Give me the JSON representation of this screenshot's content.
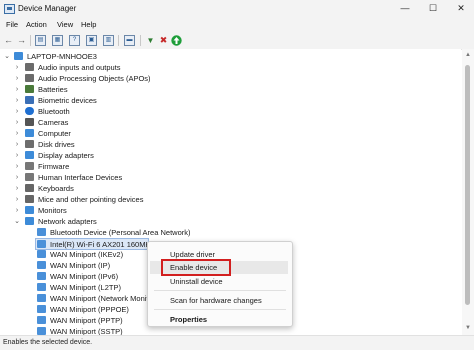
{
  "window": {
    "title": "Device Manager",
    "minimize": "—",
    "maximize": "☐",
    "close": "✕"
  },
  "menu": [
    "File",
    "Action",
    "View",
    "Help"
  ],
  "colors": {
    "accent": "#0067c0",
    "highlight_border": "#d21f1f"
  },
  "tree": {
    "root": "LAPTOP-MNHOOE3",
    "items": [
      {
        "label": "Audio inputs and outputs",
        "icon": "speaker-icon",
        "color": "#6b6b6b"
      },
      {
        "label": "Audio Processing Objects (APOs)",
        "icon": "speaker-icon",
        "color": "#6b6b6b"
      },
      {
        "label": "Batteries",
        "icon": "battery-icon",
        "color": "#4a7a3a"
      },
      {
        "label": "Biometric devices",
        "icon": "fingerprint-icon",
        "color": "#3b6fb6"
      },
      {
        "label": "Bluetooth",
        "icon": "bluetooth-icon",
        "color": "#1f6fd1"
      },
      {
        "label": "Cameras",
        "icon": "camera-icon",
        "color": "#555555"
      },
      {
        "label": "Computer",
        "icon": "computer-icon",
        "color": "#3d8bd8"
      },
      {
        "label": "Disk drives",
        "icon": "disk-icon",
        "color": "#6d6d6d"
      },
      {
        "label": "Display adapters",
        "icon": "display-icon",
        "color": "#3d8bd8"
      },
      {
        "label": "Firmware",
        "icon": "chip-icon",
        "color": "#777777"
      },
      {
        "label": "Human Interface Devices",
        "icon": "hid-icon",
        "color": "#777777"
      },
      {
        "label": "Keyboards",
        "icon": "keyboard-icon",
        "color": "#666666"
      },
      {
        "label": "Mice and other pointing devices",
        "icon": "mouse-icon",
        "color": "#666666"
      },
      {
        "label": "Monitors",
        "icon": "monitor-icon",
        "color": "#3d8bd8"
      },
      {
        "label": "Network adapters",
        "icon": "network-icon",
        "color": "#3d8bd8"
      }
    ],
    "network_children": [
      "Bluetooth Device (Personal Area Network)",
      "Intel(R) Wi-Fi 6 AX201 160MHz",
      "WAN Miniport (IKEv2)",
      "WAN Miniport (IP)",
      "WAN Miniport (IPv6)",
      "WAN Miniport (L2TP)",
      "WAN Miniport (Network Monit",
      "WAN Miniport (PPPOE)",
      "WAN Miniport (PPTP)",
      "WAN Miniport (SSTP)"
    ]
  },
  "context_menu": {
    "update_driver": "Update driver",
    "enable_device": "Enable device",
    "uninstall_device": "Uninstall device",
    "scan": "Scan for hardware changes",
    "properties": "Properties"
  },
  "status": "Enables the selected device."
}
